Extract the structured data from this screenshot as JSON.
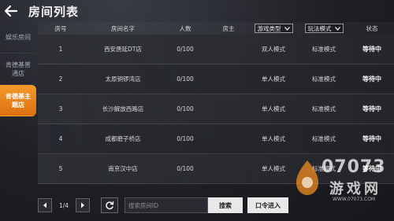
{
  "header": {
    "title": "房间列表"
  },
  "sidebar": {
    "items": [
      {
        "label": "娱乐房间",
        "active": false
      },
      {
        "label": "肯德基普通店",
        "active": false
      },
      {
        "label": "肯德基主题店",
        "active": true
      }
    ]
  },
  "table": {
    "headers": {
      "num": "房号",
      "name": "房间名字",
      "people": "人数",
      "host": "房主",
      "game_type": "游戏类型",
      "play_mode": "玩法模式",
      "status": "状态"
    },
    "rows": [
      {
        "num": "1",
        "name": "西安唐延DT店",
        "people": "0/100",
        "host": "",
        "game_type": "双人模式",
        "play_mode": "标准模式",
        "status": "等待中"
      },
      {
        "num": "2",
        "name": "太原铜锣湾店",
        "people": "0/100",
        "host": "",
        "game_type": "单人模式",
        "play_mode": "标准模式",
        "status": "等待中"
      },
      {
        "num": "3",
        "name": "长沙解放西路店",
        "people": "0/100",
        "host": "",
        "game_type": "单人模式",
        "play_mode": "标准模式",
        "status": "等待中"
      },
      {
        "num": "4",
        "name": "成都磨子桥店",
        "people": "0/100",
        "host": "",
        "game_type": "单人模式",
        "play_mode": "标准模式",
        "status": "等待中"
      },
      {
        "num": "5",
        "name": "南京汉中店",
        "people": "0/100",
        "host": "",
        "game_type": "单人模式",
        "play_mode": "标准模式",
        "status": "等待中"
      }
    ]
  },
  "footer": {
    "page_indicator": "1/4",
    "search_placeholder": "搜索房间ID",
    "search_label": "搜索",
    "command_label": "口令进入"
  },
  "watermark": {
    "line1": "07073",
    "line2": "游戏网",
    "url": "WWW.07073.COM"
  },
  "colors": {
    "accent": "#e8801c",
    "background": "#1f2026"
  },
  "icons": {
    "back": "back-arrow-icon",
    "prev": "chevron-left-icon",
    "next": "chevron-right-icon",
    "refresh": "refresh-icon",
    "dropdown": "chevron-down-icon"
  }
}
